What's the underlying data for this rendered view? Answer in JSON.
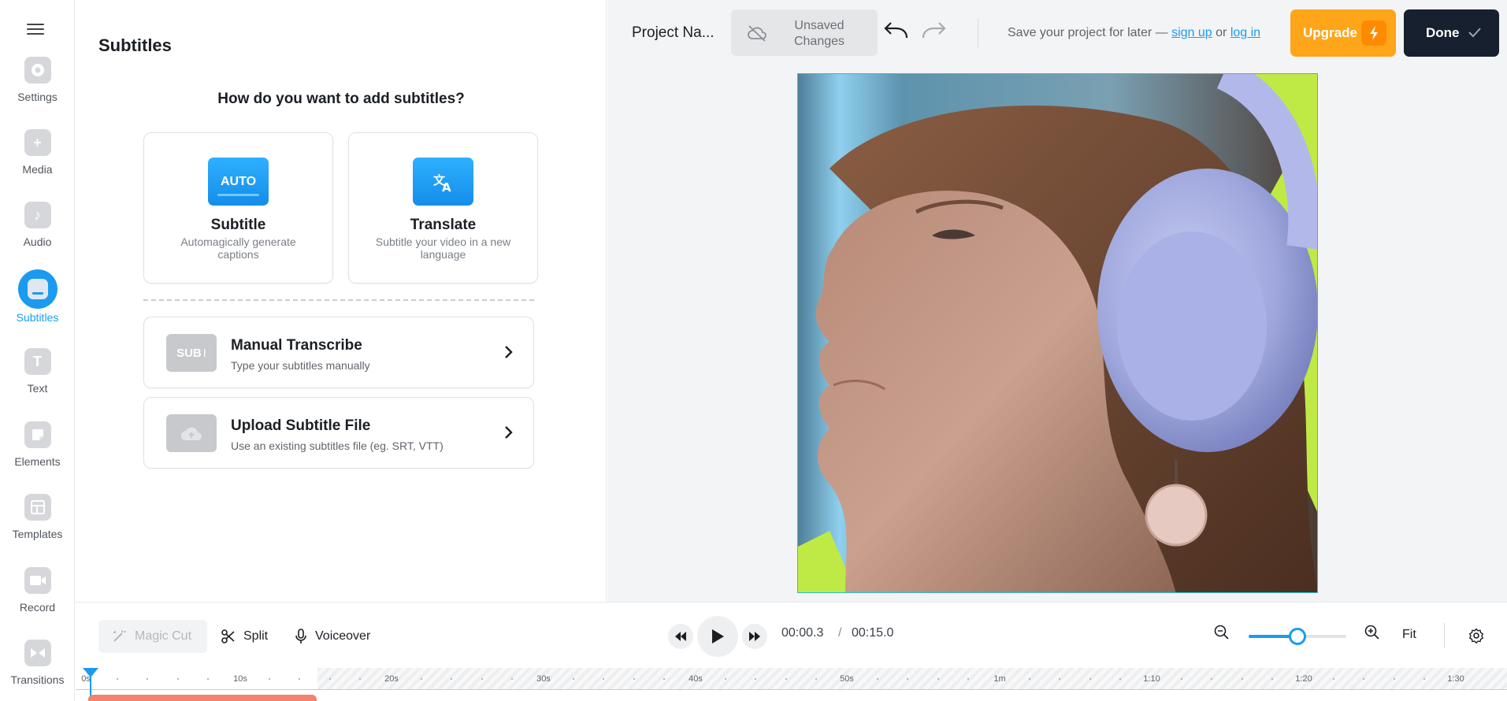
{
  "rail": {
    "items": [
      {
        "label": "Settings",
        "icon": "gear-icon"
      },
      {
        "label": "Media",
        "icon": "plus-icon"
      },
      {
        "label": "Audio",
        "icon": "music-note-icon"
      },
      {
        "label": "Subtitles",
        "icon": "subtitles-icon",
        "active": true
      },
      {
        "label": "Text",
        "icon": "text-icon"
      },
      {
        "label": "Elements",
        "icon": "sticker-icon"
      },
      {
        "label": "Templates",
        "icon": "layout-icon"
      },
      {
        "label": "Record",
        "icon": "camera-icon"
      },
      {
        "label": "Transitions",
        "icon": "transition-icon"
      }
    ]
  },
  "panel": {
    "title": "Subtitles",
    "question": "How do you want to add subtitles?",
    "auto_card": {
      "badge": "AUTO",
      "title": "Subtitle",
      "desc": "Automagically generate captions"
    },
    "translate_card": {
      "title": "Translate",
      "desc": "Subtitle your video in a new language"
    },
    "manual": {
      "badge": "SUB",
      "title": "Manual Transcribe",
      "desc": "Type your subtitles manually"
    },
    "upload": {
      "title": "Upload Subtitle File",
      "desc": "Use an existing subtitles file (eg. SRT, VTT)"
    }
  },
  "topbar": {
    "project_name": "Project Na...",
    "unsaved": "Unsaved Changes",
    "save_prefix": "Save your project for later —",
    "sign_up": "sign up",
    "or": "or",
    "log_in": "log in",
    "upgrade": "Upgrade",
    "done": "Done"
  },
  "controls": {
    "magic_cut": "Magic Cut",
    "split": "Split",
    "voiceover": "Voiceover",
    "current_time": "00:00.3",
    "separator": "/",
    "total_time": "00:15.0",
    "fit": "Fit",
    "zoom_level": 0.5
  },
  "timeline": {
    "ticks": [
      "0s",
      "10s",
      "20s",
      "30s",
      "40s",
      "50s",
      "1m",
      "1:10",
      "1:20",
      "1:30"
    ]
  },
  "colors": {
    "accent": "#1a9bf0",
    "upgrade": "#ffa51a",
    "done": "#17202f",
    "clip": "#f1836f",
    "lime": "#bfea45"
  }
}
